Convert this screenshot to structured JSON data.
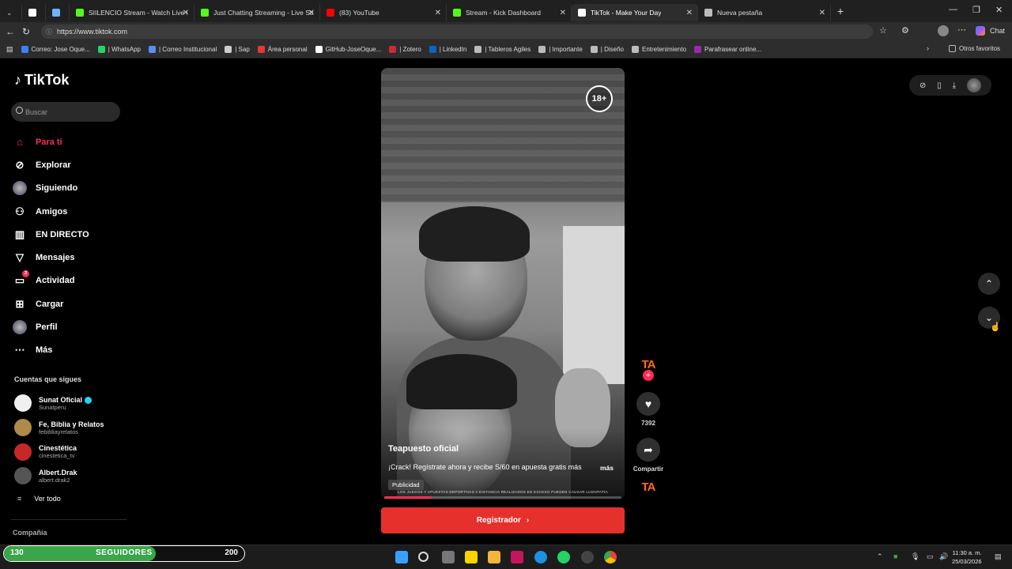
{
  "browser": {
    "tabs": [
      {
        "title": "SIILENCIO Stream - Watch Live on",
        "color": "#53fc18",
        "active": false
      },
      {
        "title": "Just Chatting Streaming - Live Stre",
        "color": "#53fc18",
        "active": false
      },
      {
        "title": "(83) YouTube",
        "color": "#ff0000",
        "active": false
      },
      {
        "title": "Stream - Kick Dashboard",
        "color": "#53fc18",
        "active": false
      },
      {
        "title": "TikTok - Make Your Day",
        "color": "#ffffff",
        "active": true
      },
      {
        "title": "Nueva pestaña",
        "color": "#bbbbbb",
        "active": false
      }
    ],
    "new_tab_icon": "plus-icon",
    "url": "https://www.tiktok.com",
    "profile_chat_label": "Chat",
    "bookmarks": [
      {
        "label": "Correo: Jose Oque...",
        "color": "#3b82f6"
      },
      {
        "label": "| WhatsApp",
        "color": "#25d366"
      },
      {
        "label": "| Correo Institucional",
        "color": "#5b8def"
      },
      {
        "label": "| Sap",
        "color": "#cccccc"
      },
      {
        "label": "Área personal",
        "color": "#e53935"
      },
      {
        "label": "GitHub-JoseOque...",
        "color": "#ffffff"
      },
      {
        "label": "| Zotero",
        "color": "#cc2936"
      },
      {
        "label": "| LinkedIn",
        "color": "#0a66c2"
      },
      {
        "label": "| Tableros Agiles",
        "color": "#bbbbbb"
      },
      {
        "label": "| Importante",
        "color": "#bbbbbb"
      },
      {
        "label": "| Diseño",
        "color": "#bbbbbb"
      },
      {
        "label": "Entretenimiento",
        "color": "#bbbbbb"
      },
      {
        "label": "Parafrasear online...",
        "color": "#9c27b0"
      }
    ],
    "other_bookmarks": "Otros favoritos"
  },
  "tiktok": {
    "logo_text": "TikTok",
    "search_placeholder": "Buscar",
    "menu": [
      {
        "label": "Para ti",
        "icon": "home-icon",
        "active": true
      },
      {
        "label": "Explorar",
        "icon": "compass-icon",
        "active": false
      },
      {
        "label": "Siguiendo",
        "icon": "following-avatar-icon",
        "active": false
      },
      {
        "label": "Amigos",
        "icon": "friends-icon",
        "active": false
      },
      {
        "label": "EN DIRECTO",
        "icon": "live-icon",
        "active": false
      },
      {
        "label": "Mensajes",
        "icon": "messages-icon",
        "active": false
      },
      {
        "label": "Actividad",
        "icon": "activity-icon",
        "active": false,
        "badge": "3"
      },
      {
        "label": "Cargar",
        "icon": "upload-icon",
        "active": false
      },
      {
        "label": "Perfil",
        "icon": "profile-avatar-icon",
        "active": false
      },
      {
        "label": "Más",
        "icon": "more-icon",
        "active": false
      }
    ],
    "following_header": "Cuentas que sigues",
    "following": [
      {
        "name": "Sunat Oficial",
        "handle": "Sunatperu",
        "verified": true,
        "color": "#f0f0f0"
      },
      {
        "name": "Fe, Biblia y Relatos",
        "handle": "febibliayrelatos",
        "verified": false,
        "color": "#b08a4a"
      },
      {
        "name": "Cinestética",
        "handle": "cinestetica_tv",
        "verified": false,
        "color": "#c62828"
      },
      {
        "name": "Albert.Drak",
        "handle": "albert.drak2",
        "verified": false,
        "color": "#555555"
      }
    ],
    "see_all": "Ver todo",
    "company": "Compañía",
    "video": {
      "age_badge": "18+",
      "author": "Teapuesto oficial",
      "caption": "¡Crack! Regístrate ahora y recibe S/60 en apuesta gratis más",
      "more": "más",
      "tag": "Publicidad",
      "disclaimer": "LOS JUEGOS Y APUESTAS DEPORTIVAS A DISTANCIA REALIZADOS EN EXCESO PUEDEN CAUSAR LUDOPATÍA",
      "progress_fraction": 0.2
    },
    "cta_label": "Registrador",
    "actions": {
      "brand": "TA",
      "likes": "7392",
      "share_label": "Compartir"
    }
  },
  "overlay": {
    "min": "130",
    "label": "SEGUIDORES",
    "max": "200",
    "progress_fraction": 0.63
  },
  "taskbar": {
    "time": "11:30 a. m.",
    "date": "25/03/2026"
  }
}
